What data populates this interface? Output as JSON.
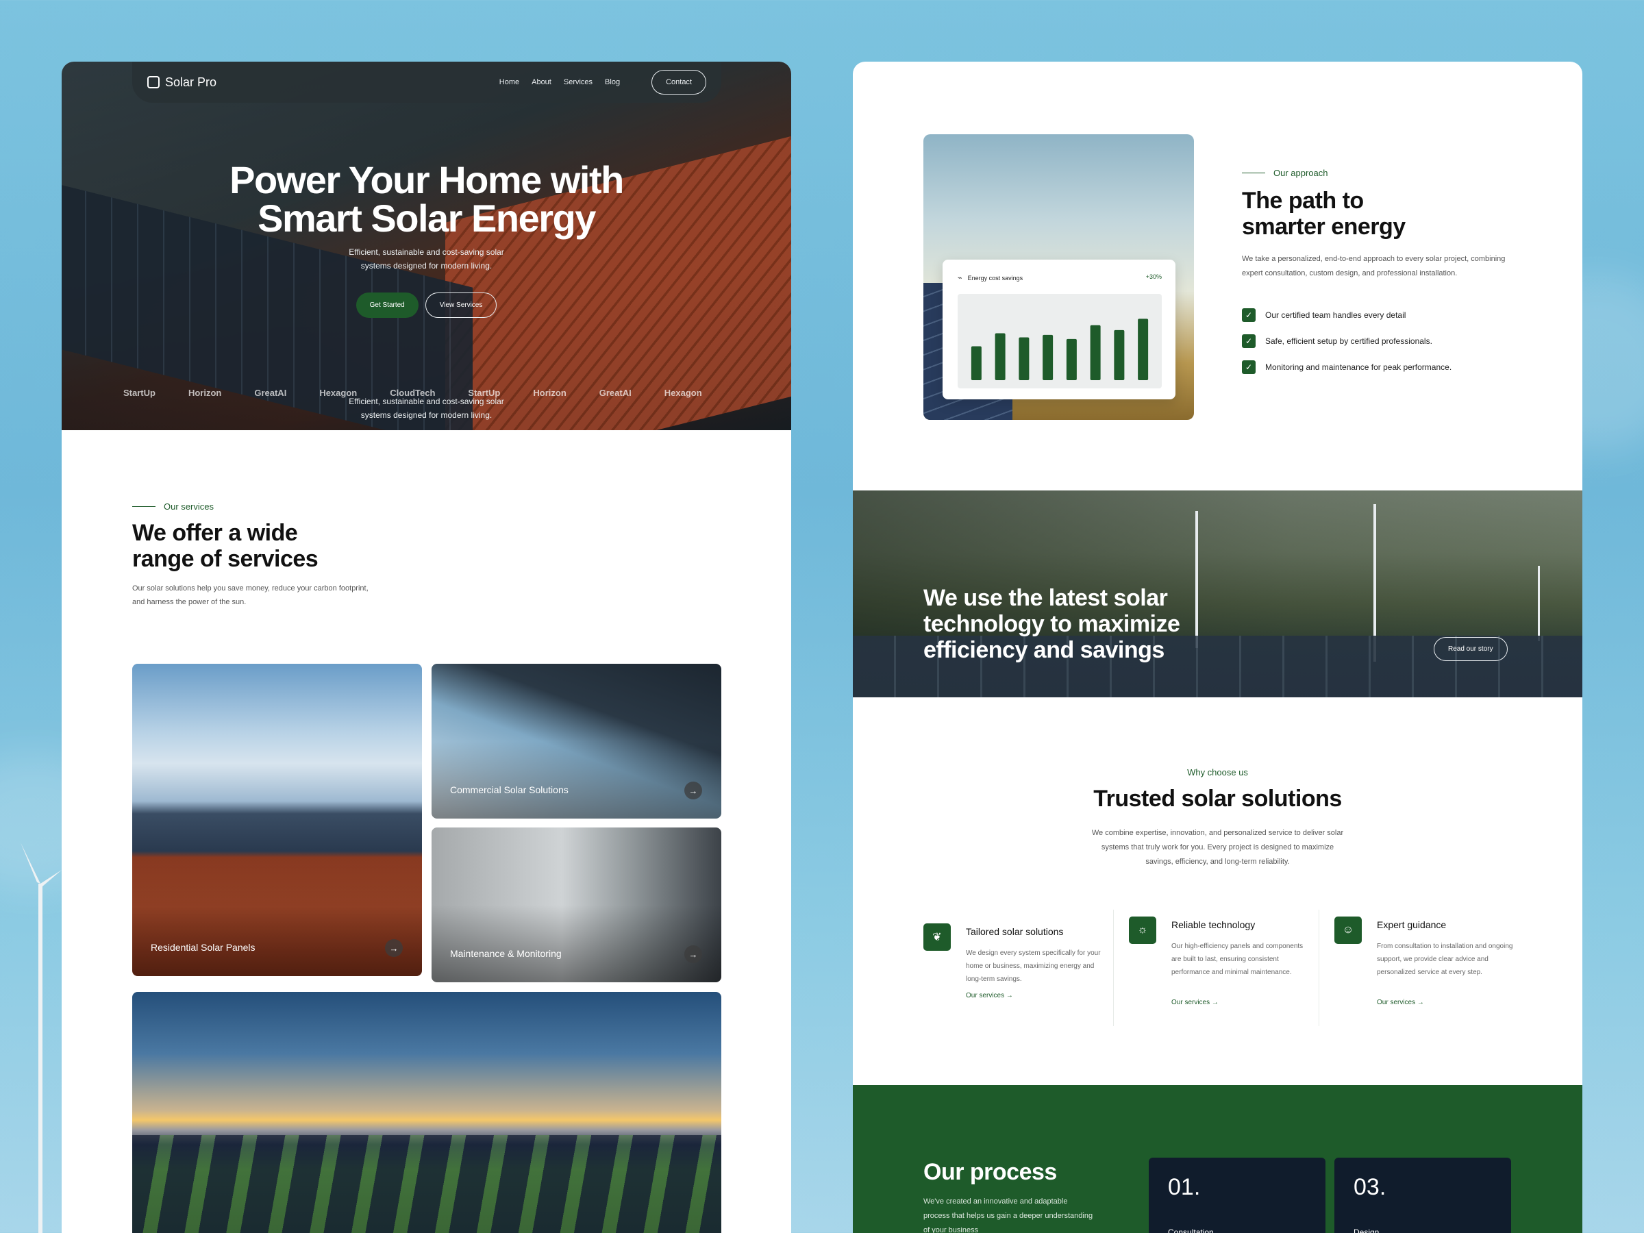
{
  "site": {
    "brand": "Solar Pro"
  },
  "nav": {
    "links": [
      "Home",
      "About",
      "Services",
      "Blog"
    ],
    "contact_label": "Contact"
  },
  "hero": {
    "title_line1": "Power Your Home with",
    "title_line2": "Smart Solar Energy",
    "subtitle_line1": "Efficient, sustainable and cost-saving solar",
    "subtitle_line2": "systems designed for modern living.",
    "primary_btn": "Get Started",
    "secondary_btn": "View Services",
    "brands": [
      "StartUp",
      "Horizon",
      "GreatAI",
      "Hexagon",
      "CloudTech",
      "StartUp",
      "Horizon",
      "GreatAI",
      "Hexagon"
    ]
  },
  "services": {
    "eyebrow": "Our services",
    "title_line1": "We offer a wide",
    "title_line2": "range of services",
    "description": "Our solar solutions help you save money, reduce your carbon footprint, and harness the power of the sun.",
    "cards": [
      {
        "label": "Residential Solar Panels"
      },
      {
        "label": "Commercial Solar Solutions"
      },
      {
        "label": "Maintenance & Monitoring"
      }
    ]
  },
  "approach": {
    "eyebrow": "Our approach",
    "title_line1": "The path to",
    "title_line2": "smarter energy",
    "description": "We take a personalized, end-to-end approach to every solar project, combining expert consultation, custom design, and professional installation.",
    "checks": [
      "Our certified team handles every detail",
      "Safe, efficient setup by certified professionals.",
      "Monitoring and maintenance for peak performance."
    ],
    "chart_title": "Energy cost savings",
    "chart_delta": "+30%"
  },
  "chart_data": {
    "type": "bar",
    "title": "Energy cost savings",
    "categories": [
      "1",
      "2",
      "3",
      "4",
      "5",
      "6",
      "7",
      "8"
    ],
    "values": [
      42,
      58,
      53,
      56,
      51,
      68,
      62,
      76
    ],
    "ylim": [
      0,
      100
    ],
    "xlabel": "",
    "ylabel": "",
    "grid": false,
    "bar_color": "#1e5b2a"
  },
  "banner": {
    "line1": "We use the latest solar",
    "line2": "technology to maximize",
    "line3": "efficiency and savings",
    "button": "Read our story"
  },
  "why": {
    "eyebrow": "Why choose us",
    "title": "Trusted solar solutions",
    "desc_line1": "We combine expertise, innovation, and personalized service to deliver solar",
    "desc_line2": "systems that truly work for you. Every project is designed to maximize",
    "desc_line3": "savings, efficiency, and long-term reliability.",
    "features": [
      {
        "icon": "leaf-icon",
        "title": "Tailored solar solutions",
        "text": "We design every system specifically for your home or business, maximizing energy and long-term savings.",
        "link": "Our services →"
      },
      {
        "icon": "sun-icon",
        "title": "Reliable technology",
        "text": "Our high-efficiency panels and components are built to last, ensuring consistent performance and minimal maintenance.",
        "link": "Our services →"
      },
      {
        "icon": "user-icon",
        "title": "Expert guidance",
        "text": "From consultation to installation and ongoing support, we provide clear advice and personalized service at every step.",
        "link": "Our services →"
      }
    ]
  },
  "process": {
    "title": "Our process",
    "desc_line1": "We've created an innovative and adaptable",
    "desc_line2": "process that helps us gain a deeper understanding",
    "desc_line3": "of your business",
    "steps": [
      {
        "num": "01.",
        "label": "Consultation"
      },
      {
        "num": "03.",
        "label": "Design"
      }
    ]
  },
  "colors": {
    "accent": "#1e5b2a",
    "dark": "#101c2c",
    "sky": "#7cc3df"
  }
}
